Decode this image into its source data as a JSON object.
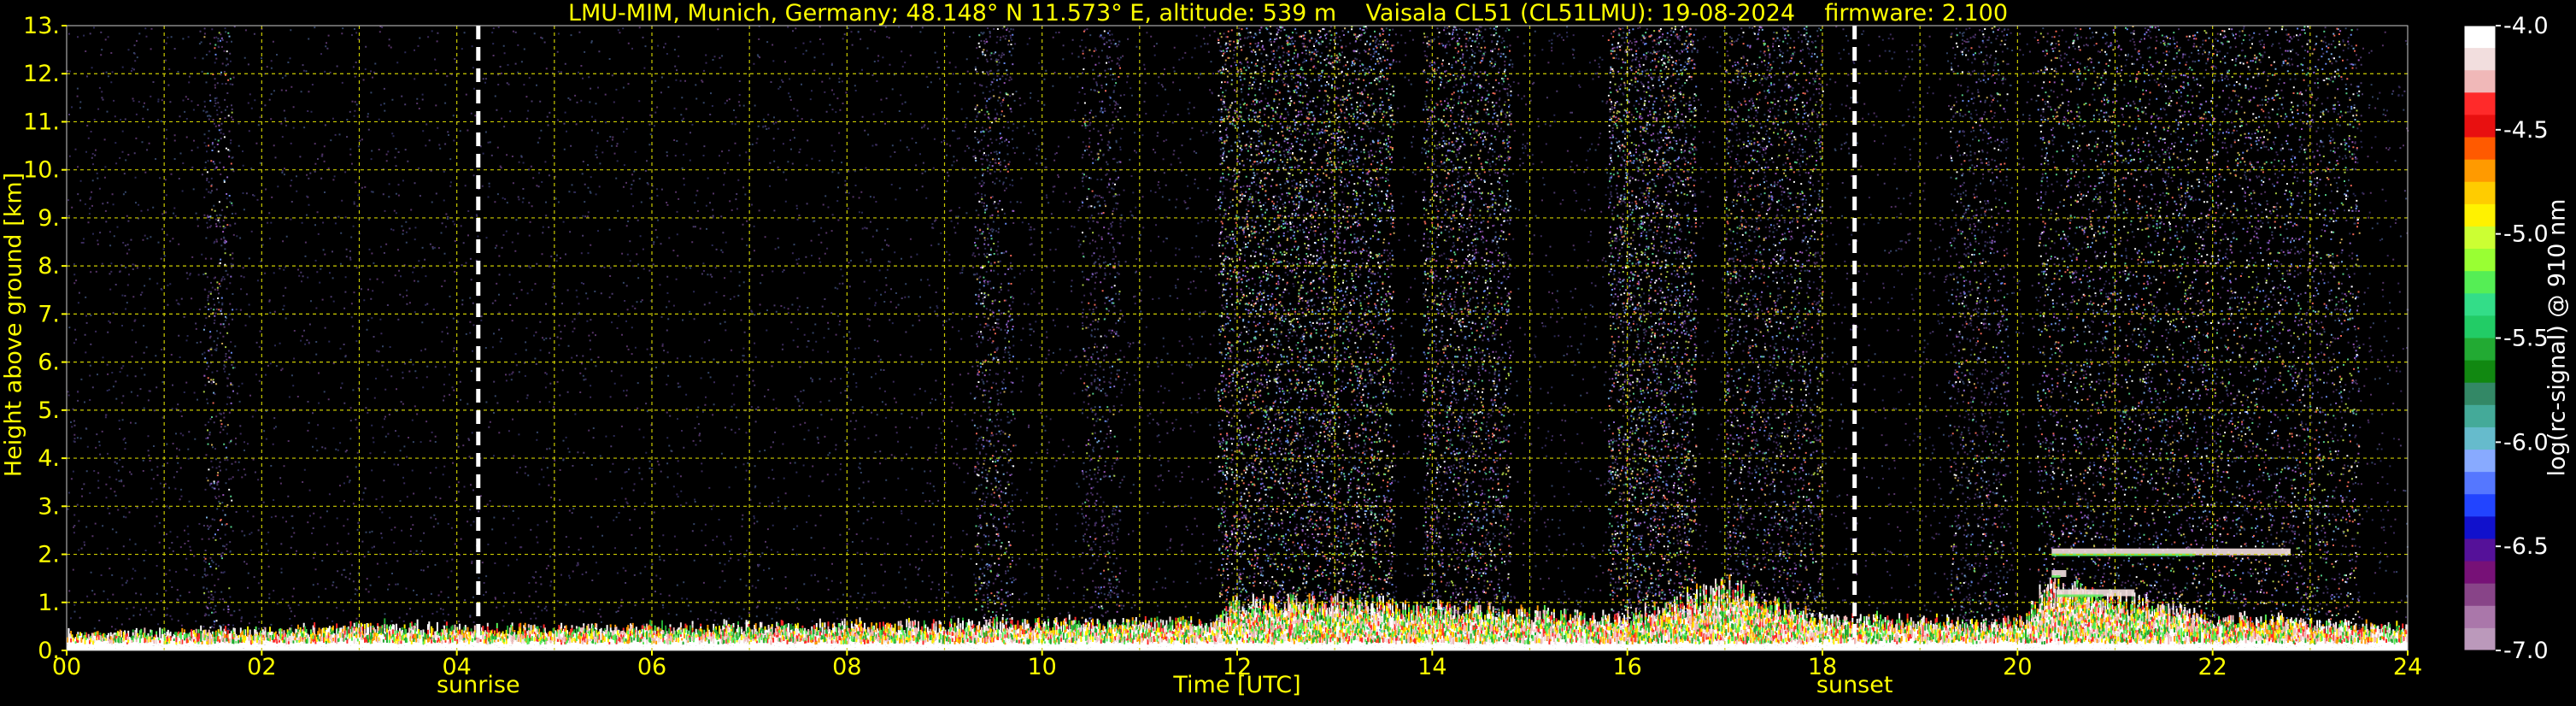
{
  "chart_data": {
    "type": "heatmap",
    "title": "LMU-MIM, Munich, Germany; 48.148° N 11.573° E, altitude: 539 m    Vaisala CL51 (CL51LMU): 19-08-2024    firmware: 2.100",
    "xlabel": "Time [UTC]",
    "ylabel": "Height above ground [km]",
    "xlim": [
      0,
      24
    ],
    "ylim": [
      0,
      13
    ],
    "x_ticks": [
      "00",
      "02",
      "04",
      "06",
      "08",
      "10",
      "12",
      "14",
      "16",
      "18",
      "20",
      "22",
      "24"
    ],
    "y_ticks": [
      "0.",
      "1.",
      "2.",
      "3.",
      "4.",
      "5.",
      "6.",
      "7.",
      "8.",
      "9.",
      "10.",
      "11.",
      "12.",
      "13."
    ],
    "grid": true,
    "events": [
      {
        "label": "sunrise",
        "x": 4.22
      },
      {
        "label": "sunset",
        "x": 18.33
      }
    ],
    "colorbar": {
      "label": "log(rc-signal) @ 910 nm",
      "range": [
        -7.0,
        -4.0
      ],
      "ticks": [
        "-4.0",
        "-4.5",
        "-5.0",
        "-5.5",
        "-6.0",
        "-6.5",
        "-7.0"
      ],
      "colors": [
        "#ffffff",
        "#f2dede",
        "#f0b8b8",
        "#ff2a2a",
        "#e81010",
        "#ff5a00",
        "#ff9a00",
        "#ffcc00",
        "#fff200",
        "#ccff33",
        "#99ff33",
        "#55ee55",
        "#33dd88",
        "#22cc66",
        "#22aa33",
        "#118811",
        "#338866",
        "#44aa99",
        "#66bbcc",
        "#88aaff",
        "#5577ff",
        "#2244ff",
        "#1111cc",
        "#551199",
        "#771177",
        "#884488",
        "#aa77aa",
        "#bb99bb"
      ]
    },
    "boundary_layer": [
      {
        "x": 0,
        "top": 0.3
      },
      {
        "x": 2,
        "top": 0.35
      },
      {
        "x": 3.4,
        "top": 0.45
      },
      {
        "x": 4,
        "top": 0.4
      },
      {
        "x": 8,
        "top": 0.45
      },
      {
        "x": 11.8,
        "top": 0.55
      },
      {
        "x": 12,
        "top": 0.9
      },
      {
        "x": 13,
        "top": 0.9
      },
      {
        "x": 14,
        "top": 0.8
      },
      {
        "x": 16,
        "top": 0.6
      },
      {
        "x": 17,
        "top": 1.2
      },
      {
        "x": 18,
        "top": 0.6
      },
      {
        "x": 20,
        "top": 0.5
      },
      {
        "x": 20.3,
        "top": 1.2
      },
      {
        "x": 21,
        "top": 1.0
      },
      {
        "x": 22,
        "top": 0.6
      },
      {
        "x": 24,
        "top": 0.4
      }
    ],
    "elevated_layers": [
      {
        "x_start": 20.35,
        "x_end": 22.8,
        "height": 2.05
      },
      {
        "x_start": 20.4,
        "x_end": 21.2,
        "height": 1.2
      },
      {
        "x_start": 20.35,
        "x_end": 20.5,
        "height": 1.6
      }
    ],
    "noisy_columns": [
      {
        "x_start": 1.4,
        "x_end": 1.7,
        "intensity": 0.35
      },
      {
        "x_start": 9.3,
        "x_end": 9.7,
        "intensity": 0.45
      },
      {
        "x_start": 10.4,
        "x_end": 10.8,
        "intensity": 0.35
      },
      {
        "x_start": 11.8,
        "x_end": 13.6,
        "intensity": 0.8
      },
      {
        "x_start": 13.9,
        "x_end": 14.8,
        "intensity": 0.6
      },
      {
        "x_start": 15.8,
        "x_end": 16.7,
        "intensity": 0.7
      },
      {
        "x_start": 17.0,
        "x_end": 18.0,
        "intensity": 0.5
      },
      {
        "x_start": 19.3,
        "x_end": 19.9,
        "intensity": 0.4
      },
      {
        "x_start": 20.2,
        "x_end": 23.5,
        "intensity": 0.7
      }
    ]
  }
}
